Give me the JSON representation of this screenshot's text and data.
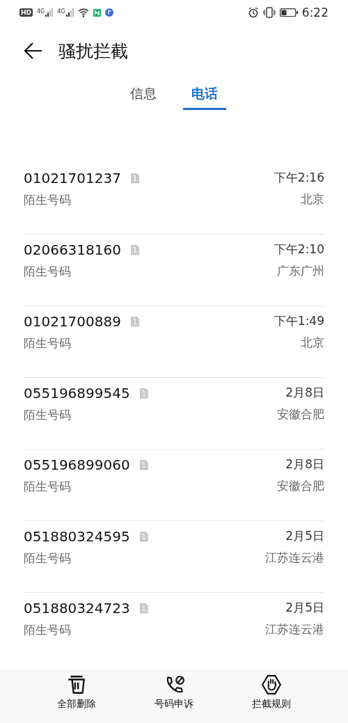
{
  "status_bar": {
    "hd": "HD",
    "networks": [
      "4G",
      "4G"
    ],
    "time": "6:22"
  },
  "header": {
    "title": "骚扰拦截"
  },
  "tabs": [
    {
      "label": "信息",
      "selected": false
    },
    {
      "label": "电话",
      "selected": true
    }
  ],
  "calls": [
    {
      "number": "01021701237",
      "sim": "1",
      "type": "陌生号码",
      "time": "下午2:16",
      "location": "北京"
    },
    {
      "number": "02066318160",
      "sim": "1",
      "type": "陌生号码",
      "time": "下午2:10",
      "location": "广东广州"
    },
    {
      "number": "01021700889",
      "sim": "1",
      "type": "陌生号码",
      "time": "下午1:49",
      "location": "北京"
    },
    {
      "number": "055196899545",
      "sim": "1",
      "type": "陌生号码",
      "time": "2月8日",
      "location": "安徽合肥"
    },
    {
      "number": "055196899060",
      "sim": "1",
      "type": "陌生号码",
      "time": "2月8日",
      "location": "安徽合肥"
    },
    {
      "number": "051880324595",
      "sim": "1",
      "type": "陌生号码",
      "time": "2月5日",
      "location": "江苏连云港"
    },
    {
      "number": "051880324723",
      "sim": "1",
      "type": "陌生号码",
      "time": "2月5日",
      "location": "江苏连云港"
    }
  ],
  "actions": [
    {
      "kind": "delete",
      "label": "全部删除"
    },
    {
      "kind": "appeal",
      "label": "号码申诉"
    },
    {
      "kind": "rules",
      "label": "拦截规则"
    }
  ]
}
